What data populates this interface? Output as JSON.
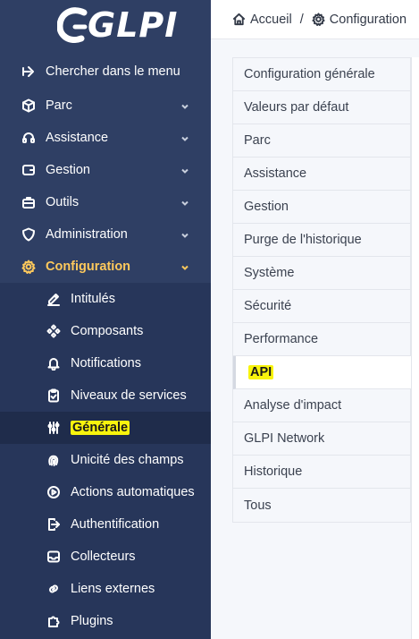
{
  "app": {
    "logo_text": "GLPI"
  },
  "breadcrumb": {
    "home": "Accueil",
    "separator": "/",
    "current": "Configuration"
  },
  "sidebar": {
    "search_label": "Chercher dans le menu",
    "items": [
      {
        "label": "Parc",
        "icon": "cube-icon"
      },
      {
        "label": "Assistance",
        "icon": "headset-icon"
      },
      {
        "label": "Gestion",
        "icon": "wallet-icon"
      },
      {
        "label": "Outils",
        "icon": "briefcase-icon"
      },
      {
        "label": "Administration",
        "icon": "shield-icon"
      },
      {
        "label": "Configuration",
        "icon": "gear-icon"
      }
    ],
    "sub_items": [
      {
        "label": "Intitulés",
        "icon": "edit-icon"
      },
      {
        "label": "Composants",
        "icon": "components-icon"
      },
      {
        "label": "Notifications",
        "icon": "bell-icon"
      },
      {
        "label": "Niveaux de services",
        "icon": "clipboard-check-icon"
      },
      {
        "label": "Générale",
        "icon": "adjustments-icon"
      },
      {
        "label": "Unicité des champs",
        "icon": "fingerprint-icon"
      },
      {
        "label": "Actions automatiques",
        "icon": "play-gear-icon"
      },
      {
        "label": "Authentification",
        "icon": "login-icon"
      },
      {
        "label": "Collecteurs",
        "icon": "inbox-icon"
      },
      {
        "label": "Liens externes",
        "icon": "link-icon"
      },
      {
        "label": "Plugins",
        "icon": "puzzle-icon"
      }
    ]
  },
  "tabs": [
    "Configuration générale",
    "Valeurs par défaut",
    "Parc",
    "Assistance",
    "Gestion",
    "Purge de l'historique",
    "Système",
    "Sécurité",
    "Performance",
    "API",
    "Analyse d'impact",
    "GLPI Network",
    "Historique",
    "Tous"
  ],
  "colors": {
    "sidebar_bg": "#2f3f64",
    "active_accent": "#fec95c",
    "highlight": "#f8f40d"
  }
}
